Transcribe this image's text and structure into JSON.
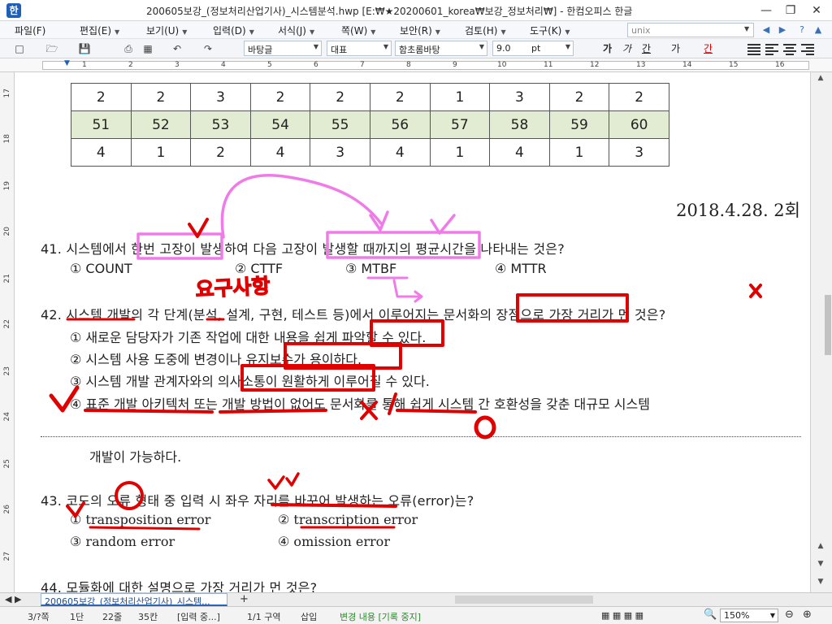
{
  "window": {
    "title": "200605보강_(정보처리산업기사)_시스템분석.hwp [E:₩★20200601_korea₩보강_정보처리₩] - 한컴오피스 한글",
    "app_icon": "한"
  },
  "menubar": {
    "items": [
      "파일(F)",
      "편집(E)",
      "보기(U)",
      "입력(D)",
      "서식(J)",
      "쪽(W)",
      "보안(R)",
      "검토(H)",
      "도구(K)"
    ],
    "search_value": "unix"
  },
  "toolbar": {
    "style_combo": "바탕글",
    "lang_combo": "대표",
    "font_combo": "함초롬바탕",
    "size_combo": "9.0",
    "size_unit": "pt",
    "bold": "가",
    "italic": "가",
    "underline": "간",
    "strike": "가",
    "color": "간"
  },
  "ruler": {
    "marks": [
      "1",
      "2",
      "3",
      "4",
      "5",
      "6",
      "7",
      "8",
      "9",
      "10",
      "11",
      "12",
      "13",
      "14",
      "15",
      "16"
    ]
  },
  "vruler": {
    "marks": [
      "17",
      "18",
      "19",
      "20",
      "21",
      "22",
      "23",
      "24",
      "25",
      "26",
      "27"
    ]
  },
  "table": {
    "rows": [
      {
        "kind": "body",
        "cells": [
          "2",
          "2",
          "3",
          "2",
          "2",
          "2",
          "1",
          "3",
          "2",
          "2"
        ]
      },
      {
        "kind": "head",
        "cells": [
          "51",
          "52",
          "53",
          "54",
          "55",
          "56",
          "57",
          "58",
          "59",
          "60"
        ]
      },
      {
        "kind": "body",
        "cells": [
          "4",
          "1",
          "2",
          "4",
          "3",
          "4",
          "1",
          "4",
          "1",
          "3"
        ]
      }
    ]
  },
  "exam_date": "2018.4.28. 2회",
  "questions": {
    "q41": {
      "text": "41. 시스템에서 한번 고장이 발생하여 다음 고장이 발생할 때까지의 평균시간을 나타내는 것은?",
      "options": [
        "① COUNT",
        "② CTTF",
        "③ MTBF",
        "④ MTTR"
      ]
    },
    "q42": {
      "text": "42. 시스템 개발의 각 단계(분석, 설계, 구현, 테스트 등)에서 이루어지는 문서화의 장점으로 가장 거리가 먼 것은?",
      "options": [
        "① 새로운 담당자가 기존 작업에 대한 내용을 쉽게 파악할 수 있다.",
        "② 시스템 사용 도중에 변경이나 유지보수가 용이하다.",
        "③ 시스템 개발 관계자와의 의사소통이 원활하게 이루어질 수 있다.",
        "④ 표준 개발 아키텍처 또는 개발 방법이 없어도 문서화를 통해 쉽게 시스템 간 호환성을 갖춘 대규모 시스템"
      ],
      "continuation": "개발이 가능하다."
    },
    "q43": {
      "text": "43. 코드의 오류 형태 중 입력 시 좌우 자리를 바꾸어 발생하는 오류(error)는?",
      "options": [
        "① transposition error",
        "② transcription error",
        "③ random error",
        "④ omission error"
      ]
    },
    "q44": {
      "text": "44. 모듈화에 대한 설명으로 가장 거리가 먼 것은?"
    }
  },
  "annotations": {
    "handwritten_note": "요구사항"
  },
  "tabbar": {
    "doc_tab": "200605보강_(정보처리산업기사)_시스템...",
    "add": "+"
  },
  "statusbar": {
    "page": "3/?쪽",
    "section": "1단",
    "line": "22줄",
    "column": "35칸",
    "input_state": "[입력 중...]",
    "zone": "1/1 구역",
    "insert_mode": "삽입",
    "track_changes": "변경 내용 [기록 중지]",
    "zoom": "150%"
  },
  "colors": {
    "pen_red": "#e00000",
    "pen_pink": "#f07be8",
    "table_header_bg": "#e1ecd2",
    "track_changes_text": "#2a8a2a"
  }
}
